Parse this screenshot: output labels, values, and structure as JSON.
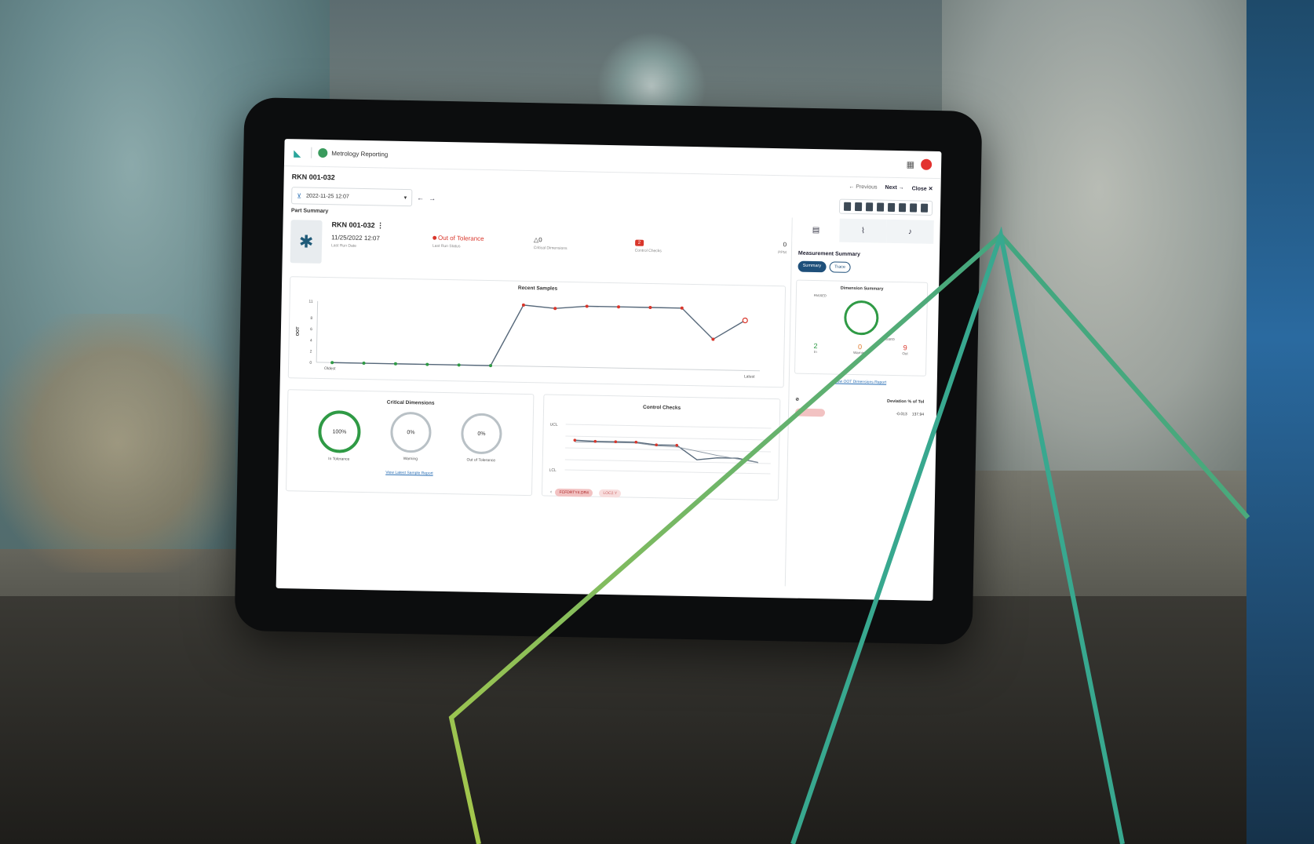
{
  "app": {
    "name": "Metrology Reporting"
  },
  "part": {
    "id": "RKN 001-032"
  },
  "nav": {
    "previous": "← Previous",
    "next": "Next →",
    "close": "Close ✕"
  },
  "date_filter": {
    "value": "2022-11-25 12:07"
  },
  "part_summary": {
    "label": "Part Summary",
    "name": "RKN 001-032",
    "last_run_date": "11/25/2022 12:07",
    "last_run_date_label": "Last Run Date",
    "last_run_status": "Out of Tolerance",
    "last_run_status_label": "Last Run Status",
    "critical_dimensions": "△0",
    "critical_dimensions_label": "Critical Dimensions",
    "control_checks": "2",
    "control_checks_label": "Control Checks",
    "ppm": "0",
    "ppm_label": "PPM"
  },
  "chart_data": {
    "type": "line",
    "title": "Recent Samples",
    "ylabel": "OOT",
    "xlabel": "",
    "x_start_label": "Oldest",
    "x_end_label": "Latest",
    "yticks": [
      0,
      2,
      4,
      6,
      8,
      11
    ],
    "ylim": [
      0,
      11
    ],
    "series": [
      {
        "values": [
          0,
          0,
          0,
          0,
          0,
          0,
          11,
          10.5,
          11,
          11,
          11,
          11,
          5.5,
          9
        ]
      }
    ],
    "colors": {
      "line": "#56687a",
      "ok": "#2f9a45",
      "oot": "#d9362b"
    }
  },
  "critical_dimensions": {
    "title": "Critical Dimensions",
    "gauges": [
      {
        "value": "100%",
        "label": "In Tolerance"
      },
      {
        "value": "0%",
        "label": "Warning"
      },
      {
        "value": "0%",
        "label": "Out of Tolerance"
      }
    ],
    "link": "View Latest Sample Report"
  },
  "control_checks": {
    "title": "Control Checks",
    "ucl": "UCL",
    "lcl": "LCL",
    "chips": [
      "FCFDRTY4.DR4",
      "LOC2.Y"
    ]
  },
  "measurement_summary": {
    "title": "Measurement Summary",
    "tabs": [
      "Summary",
      "Trace"
    ],
    "dimension_summary": {
      "title": "Dimension Summary",
      "labels": [
        "PASSED",
        "PASSED"
      ],
      "counts": [
        {
          "value": "2",
          "label": "In"
        },
        {
          "value": "0",
          "label": "Warning"
        },
        {
          "value": "9",
          "label": "Out"
        }
      ],
      "link": "View OOT Dimensions Report"
    },
    "deviation_header": "Deviation % of Tol",
    "deviation_values": [
      "-0.013",
      "137.94"
    ]
  }
}
